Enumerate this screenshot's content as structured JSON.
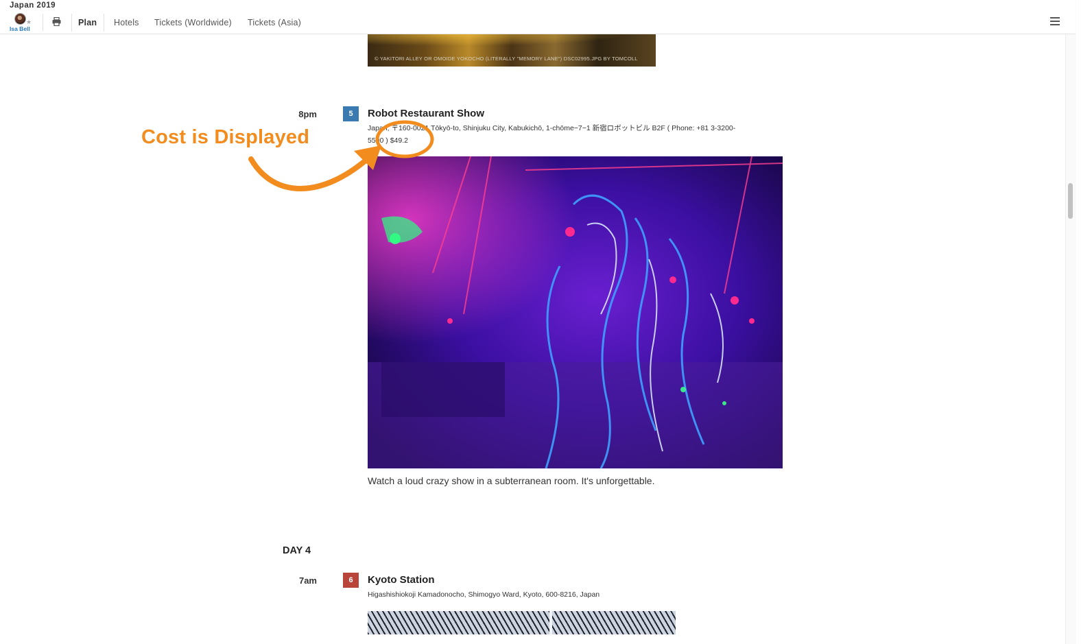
{
  "header": {
    "trip_title": "Japan 2019",
    "user_name": "Isa Bell",
    "nav": [
      "Plan",
      "Hotels",
      "Tickets (Worldwide)",
      "Tickets (Asia)"
    ],
    "active_nav": "Plan"
  },
  "prev_image_caption": "© YAKITORI ALLEY OR OMOIDE YOKOCHO (LITERALLY \"MEMORY LANE\") DSC02995.JPG BY TOMCOLL",
  "events": [
    {
      "time": "8pm",
      "number": "5",
      "badge_color": "#3b7ab0",
      "title": "Robot Restaurant Show",
      "address_line1": "Japan, 〒160-0021 Tōkyō-to, Shinjuku City, Kabukichō, 1-chōme−7−1 新宿ロボットビル B2F ( Phone: +81 3-3200-",
      "address_line2": "5500 ) $49.2",
      "description": "Watch a loud crazy show in a subterranean room. It's unforgettable."
    },
    {
      "day_label": "DAY 4",
      "time": "7am",
      "number": "6",
      "badge_color": "#b8443a",
      "title": "Kyoto Station",
      "address_line1": "Higashishiokoji Kamadonocho, Shimogyo Ward, Kyoto, 600-8216, Japan"
    }
  ],
  "annotation": {
    "text": "Cost is Displayed",
    "color": "#f28c1e"
  },
  "icons": [
    "printer-icon",
    "hamburger-menu-icon",
    "star-icon",
    "avatar"
  ]
}
